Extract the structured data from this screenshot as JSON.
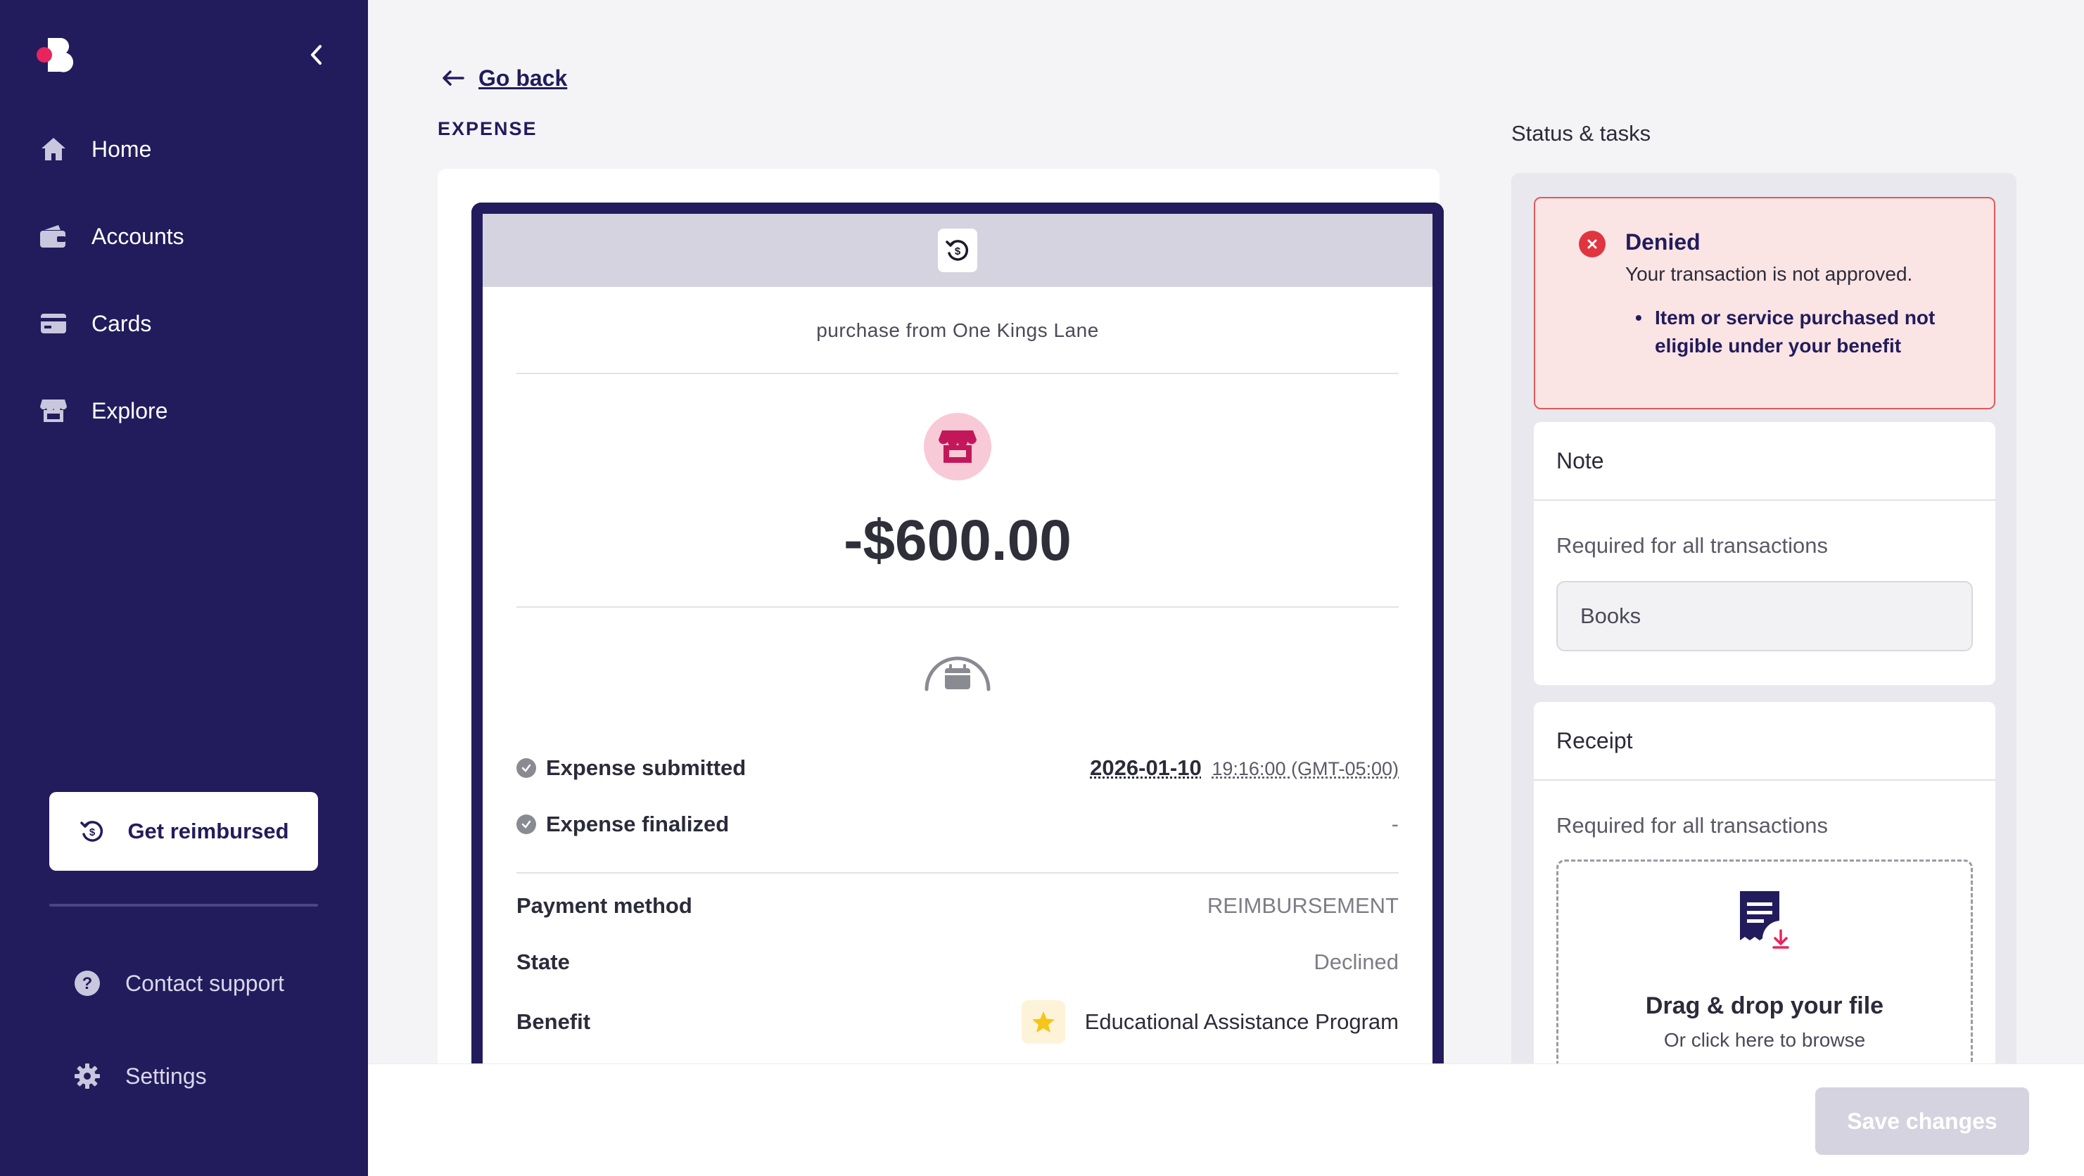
{
  "sidebar": {
    "nav": [
      {
        "label": "Home",
        "icon": "home-icon"
      },
      {
        "label": "Accounts",
        "icon": "wallet-icon"
      },
      {
        "label": "Cards",
        "icon": "card-icon"
      },
      {
        "label": "Explore",
        "icon": "store-icon"
      }
    ],
    "cta_label": "Get reimbursed",
    "contact_label": "Contact support",
    "settings_label": "Settings"
  },
  "nav_back": "Go back",
  "section_title": "EXPENSE",
  "status_title": "Status & tasks",
  "expense": {
    "merchant_line": "purchase from One Kings Lane",
    "amount": "-$600.00",
    "submitted_label": "Expense submitted",
    "submitted_date": "2026-01-10",
    "submitted_time": "19:16:00 (GMT-05:00)",
    "finalized_label": "Expense finalized",
    "finalized_value": "-",
    "payment_method_label": "Payment method",
    "payment_method_value": "REIMBURSEMENT",
    "state_label": "State",
    "state_value": "Declined",
    "benefit_label": "Benefit",
    "benefit_value": "Educational Assistance Program"
  },
  "status": {
    "title": "Denied",
    "subtitle": "Your transaction is not approved.",
    "reason": "Item or service purchased not eligible under your benefit"
  },
  "note": {
    "title": "Note",
    "required": "Required for all transactions",
    "value": "Books"
  },
  "receipt": {
    "title": "Receipt",
    "required": "Required for all transactions",
    "drop_title": "Drag & drop your file",
    "drop_sub": "Or click here to browse"
  },
  "footer": {
    "save_label": "Save changes"
  },
  "colors": {
    "sidebar_bg": "#221c5c",
    "accent": "#e8245c",
    "denied_bg": "#fbe4e4",
    "denied_border": "#e05a5a"
  }
}
